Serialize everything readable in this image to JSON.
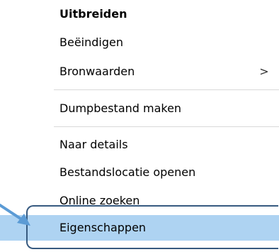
{
  "menu": {
    "items": [
      {
        "label": "Uitbreiden",
        "bold": true
      },
      {
        "label": "Beëindigen"
      },
      {
        "label": "Bronwaarden",
        "submenu_arrow": ">"
      },
      {
        "label": "Dumpbestand maken"
      },
      {
        "label": "Naar details"
      },
      {
        "label": "Bestandslocatie openen"
      },
      {
        "label": "Online zoeken"
      },
      {
        "label": "Eigenschappen",
        "highlighted": true
      }
    ]
  },
  "colors": {
    "highlight": "#aed3f2",
    "separator": "#d9d9d9",
    "callout_border": "#375a80",
    "arrow": "#5b9bd5"
  }
}
